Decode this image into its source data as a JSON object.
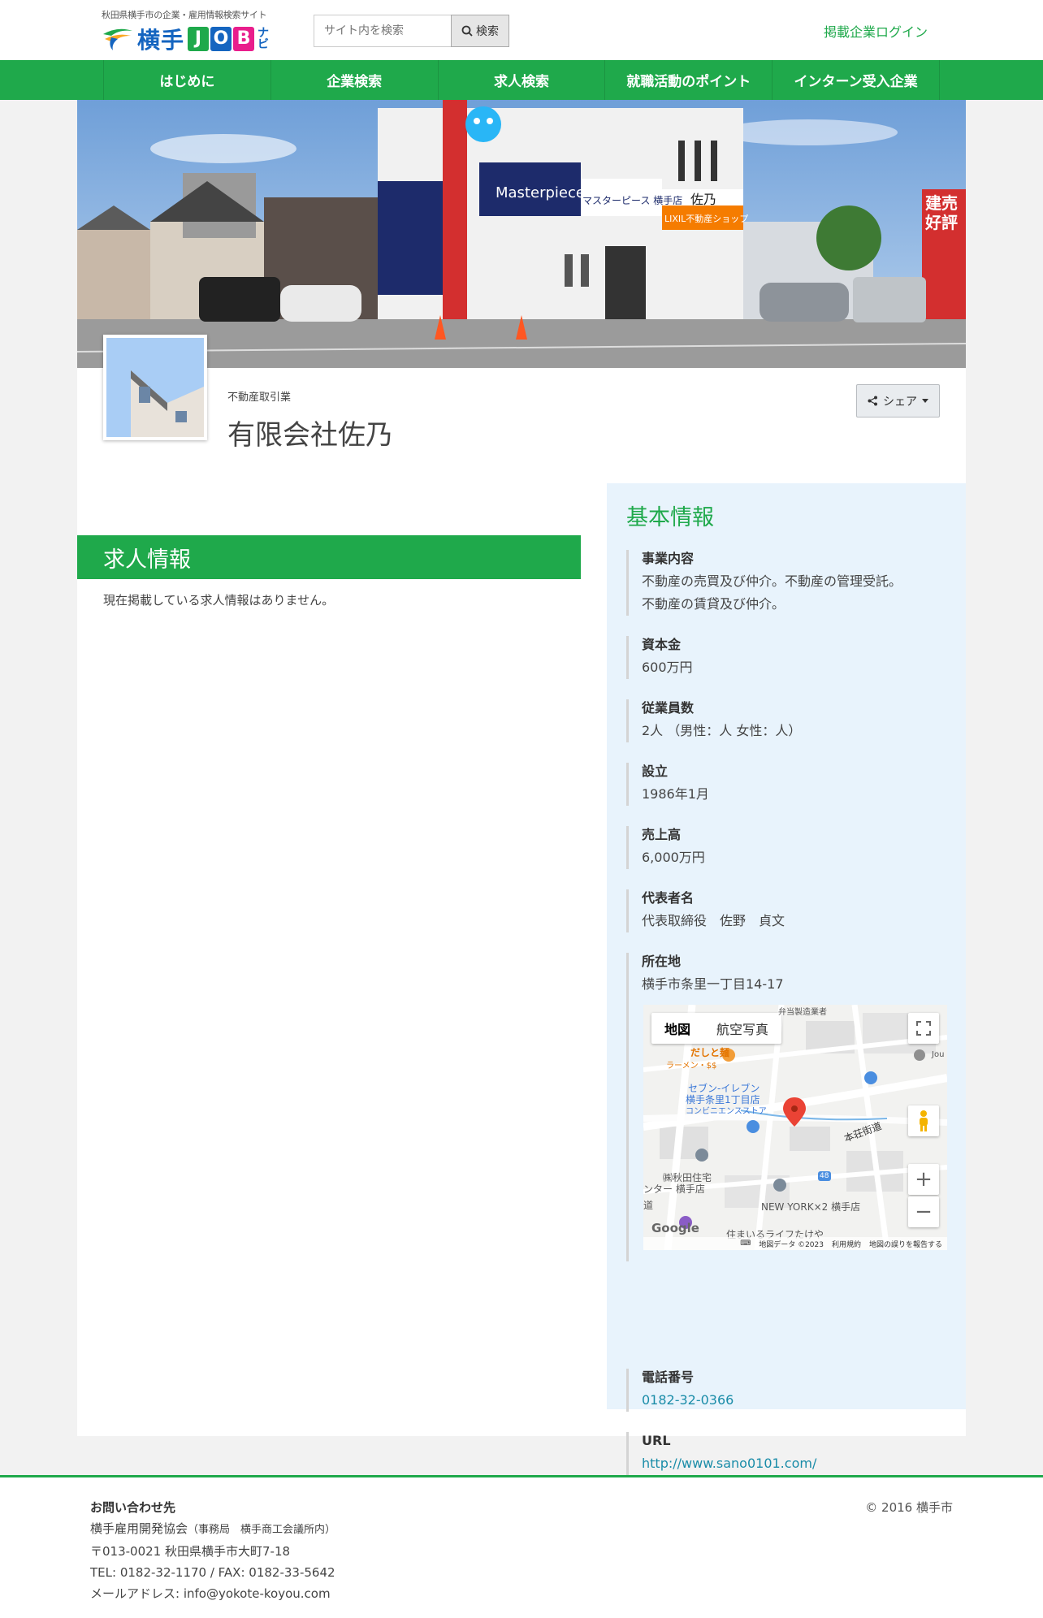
{
  "header": {
    "tagline": "秋田県横手市の企業・雇用情報検索サイト",
    "logo_text": "横手",
    "logo_job": [
      "J",
      "O",
      "B"
    ],
    "logo_navi": "ナビ",
    "search_placeholder": "サイト内を検索",
    "search_button": "検索",
    "login_link": "掲載企業ログイン"
  },
  "nav": {
    "items": [
      {
        "label": "はじめに"
      },
      {
        "label": "企業検索"
      },
      {
        "label": "求人検索"
      },
      {
        "label": "就職活動のポイント"
      },
      {
        "label": "インターン受入企業"
      }
    ]
  },
  "hero": {
    "signs": {
      "masterpiece": "Masterpiece",
      "store": "マスターピース 横手店",
      "sano": "佐乃",
      "lixil": "LIXIL不動産ショップ",
      "right_sign": "建売",
      "right_sign2": "好評"
    }
  },
  "company": {
    "category": "不動産取引業",
    "name": "有限会社佐乃",
    "share_label": "シェア"
  },
  "jobs": {
    "title": "求人情報",
    "empty_message": "現在掲載している求人情報はありません。"
  },
  "basic_info": {
    "title": "基本情報",
    "business_label": "事業内容",
    "business_line1": "不動産の売買及び仲介。不動産の管理受託。",
    "business_line2": "不動産の賃貸及び仲介。",
    "capital_label": "資本金",
    "capital": "600万円",
    "employees_label": "従業員数",
    "employees": "2人 （男性：人 女性：人）",
    "founded_label": "設立",
    "founded": "1986年1月",
    "sales_label": "売上高",
    "sales": "6,000万円",
    "rep_label": "代表者名",
    "rep": "代表取締役　佐野　貞文",
    "address_label": "所在地",
    "address": "横手市条里一丁目14-17",
    "phone_label": "電話番号",
    "phone": "0182-32-0366",
    "url_label": "URL",
    "url": "http://www.sano0101.com/"
  },
  "map": {
    "tab_map": "地図",
    "tab_satellite": "航空写真",
    "labels": {
      "l1": "だしと麺",
      "l2": "ラーメン・$$",
      "l3": "セブン-イレブン",
      "l4": "横手条里1丁目店",
      "l5": "コンビニエンスストア",
      "l6": "本荘街道",
      "l7": "㈱秋田住宅",
      "l8": "ンター 横手店",
      "l9": "NEW YORK×2 横手店",
      "l10": "住まいるライフたけや",
      "l11": "弁当製造業者",
      "l12": "Jou",
      "l13": "48",
      "l14": "道"
    },
    "google": "Google",
    "foot_data": "地図データ ©2023",
    "foot_terms": "利用規約",
    "foot_report": "地図の誤りを報告する"
  },
  "footer": {
    "title": "お問い合わせ先",
    "org": "横手雇用開発協会",
    "org_sub": "（事務局　横手商工会議所内）",
    "address": "〒013-0021 秋田県横手市大町7-18",
    "tel": "TEL: 0182-32-1170 / FAX: 0182-33-5642",
    "mail": "メールアドレス: info@yokote-koyou.com",
    "copyright": "© 2016 横手市"
  },
  "colors": {
    "brand_green": "#1fa94b",
    "panel_bg": "#e8f3fc",
    "link": "#1a8ca8",
    "logo_j": "#1fa94b",
    "logo_o": "#1565c0",
    "logo_b": "#e91e8c"
  }
}
